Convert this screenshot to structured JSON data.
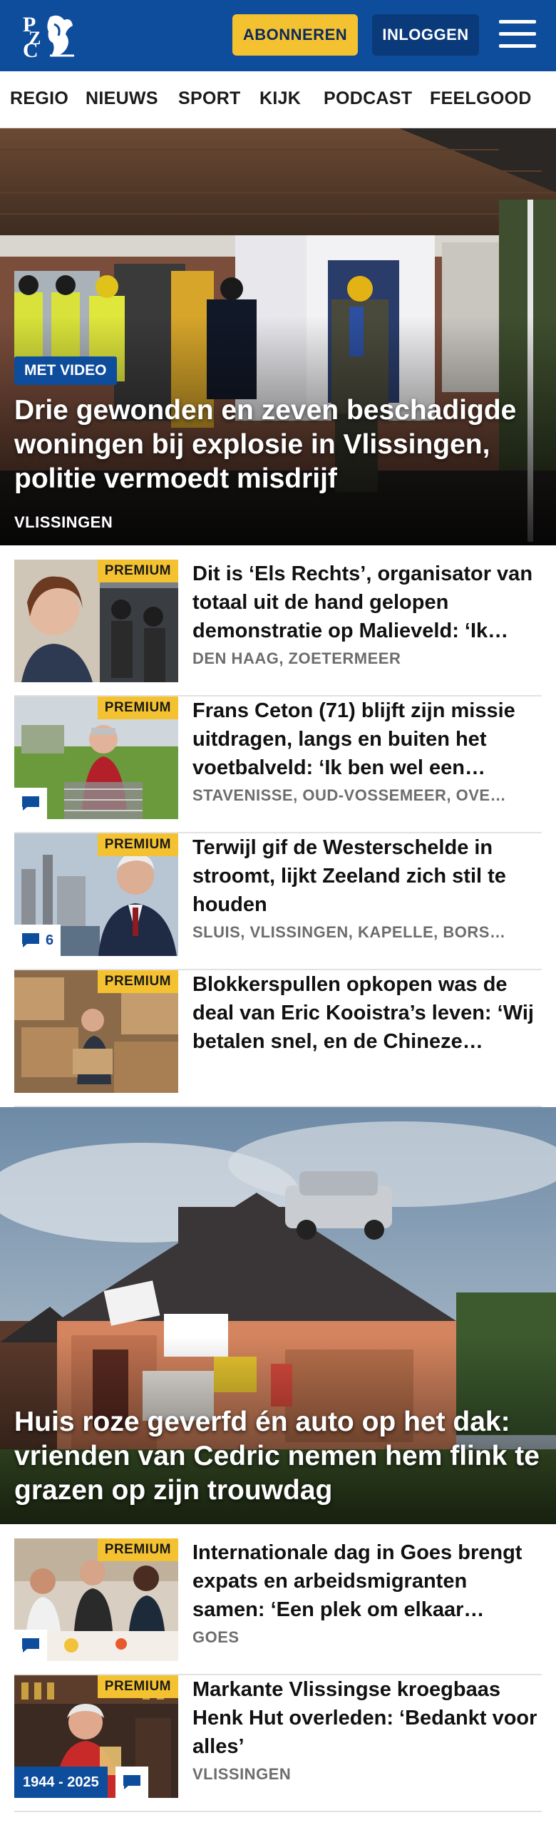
{
  "header": {
    "logo_text": "PZC",
    "subscribe_label": "ABONNEREN",
    "login_label": "INLOGGEN"
  },
  "nav": {
    "items": [
      "REGIO",
      "NIEUWS",
      "SPORT",
      "KIJK",
      "PODCAST",
      "FEELGOOD"
    ]
  },
  "hero": {
    "badge": "MET VIDEO",
    "title": "Drie gewonden en zeven beschadigde woningen bij explosie in Vlissingen, politie vermoedt misdrijf",
    "place": "VLISSINGEN"
  },
  "articles": [
    {
      "premium": "PREMIUM",
      "title": "Dit is ‘Els Rechts’, organisator van totaal uit de hand gelopen demonstratie op Malieveld: ‘Ik…",
      "place": "DEN HAAG, ZOETERMEER"
    },
    {
      "premium": "PREMIUM",
      "title": "Frans Ceton (71) blijft zijn missie uitdragen, langs en buiten het voetbalveld: ‘Ik ben wel een…",
      "place": "STAVENISSE, OUD-VOSSEMEER, OVE…"
    },
    {
      "premium": "PREMIUM",
      "title": "Terwijl gif de Westerschelde in stroomt, lijkt Zeeland zich stil te houden",
      "place": "SLUIS, VLISSINGEN, KAPELLE, BORS…",
      "comments": "6"
    },
    {
      "premium": "PREMIUM",
      "title": "Blokkerspullen opkopen was de deal van Eric Kooistra’s leven: ‘Wij betalen snel, en de Chineze…",
      "place": ""
    }
  ],
  "hero2": {
    "title": "Huis roze geverfd én auto op het dak: vrienden van Cedric nemen hem flink te grazen op zijn trouwdag"
  },
  "articles2": [
    {
      "premium": "PREMIUM",
      "title": "Internationale dag in Goes brengt expats en arbeidsmigranten samen: ‘Een plek om elkaar…",
      "place": "GOES"
    },
    {
      "premium": "PREMIUM",
      "title": "Markante Vlissingse kroegbaas Henk Hut overleden: ‘Bedankt voor alles’",
      "place": "VLISSINGEN",
      "year_tag": "1944 - 2025"
    }
  ],
  "colors": {
    "brand_blue": "#0e4c9c",
    "premium_yellow": "#f4c230"
  },
  "icons": [
    "pzc-logo",
    "hamburger-menu-icon",
    "comment-bubble-icon"
  ]
}
